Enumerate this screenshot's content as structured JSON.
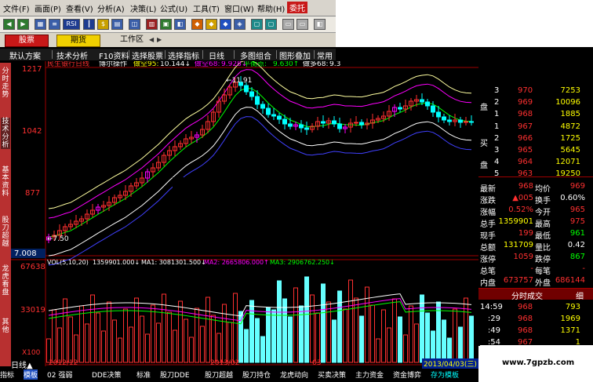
{
  "menu": [
    "文件(F)",
    "画面(P)",
    "查看(V)",
    "分析(A)",
    "决策(L)",
    "公式(U)",
    "工具(T)",
    "窗口(W)",
    "帮助(H)",
    "委托"
  ],
  "toolbar_icons": [
    "back-icon",
    "forward-icon",
    "grid-icon",
    "menu-icon",
    "rsi-icon",
    "ddd-icon",
    "ddd-icon",
    "chart-icon",
    "tool-icon",
    "tool-icon",
    "tool-icon",
    "tool-icon",
    "tool-icon",
    "window-icon",
    "window-icon",
    "window-icon",
    "tool-icon",
    "settings-icon"
  ],
  "toolbar_rsi": "RSI",
  "modtabs": {
    "stock": "股票",
    "futures": "期货",
    "workspace": "工作区"
  },
  "subtabs": [
    "默认方案",
    "技术分析",
    "F10资料",
    "选择股票",
    "选择指标",
    "日线",
    "多图组合",
    "图形叠加",
    "常用"
  ],
  "left_tabs": [
    "分时走势",
    "技术分析",
    "基本资料",
    "股刀超越",
    "龙虎看盘",
    "其他"
  ],
  "indicator": {
    "name": "民生银行日线",
    "method": "博尔操作",
    "buy95_label": "做空95:",
    "buy95_value": "10.144↓",
    "buy68_label": "做空68:",
    "buy68_value": "9.928↓",
    "mid_label": "平衡点:",
    "mid_value": "9.630↑",
    "low68_label": "做多68:",
    "low68_value": "9.3"
  },
  "price_axis": [
    "1217",
    "1042",
    "877",
    "7.008"
  ],
  "vol_axis": [
    "67638",
    "33019",
    "X100"
  ],
  "peak_label": "←11.91",
  "low_label": "←7.50",
  "vol_header": {
    "vol": "VOL(5,10,20)",
    "vol_value": "1359901.000↓",
    "ma1": "MA1: 3081301.500↓",
    "ma2": "MA2: 2665806.000↑",
    "ma3": "MA3: 2906762.250↓"
  },
  "date_labels": [
    "2012/12",
    "2013/02",
    "03"
  ],
  "bottom_bar": {
    "period": "日线▲",
    "tabs": [
      "指标",
      "模板",
      "02 强弱",
      "DDE决策",
      "标准",
      "股刀DDE",
      "股刀超越",
      "股刀持仓",
      "龙虎动向",
      "买卖决策",
      "主力资金",
      "资金博弈",
      "存为模板"
    ],
    "date": "2013/04/03(三)"
  },
  "order_book": {
    "sell": [
      {
        "lvl": "3",
        "price": "970",
        "vol": "7253"
      },
      {
        "lvl": "2",
        "price": "969",
        "vol": "10096"
      },
      {
        "lvl": "1",
        "price": "968",
        "vol": "1885"
      }
    ],
    "buy": [
      {
        "lvl": "1",
        "price": "967",
        "vol": "4872"
      },
      {
        "lvl": "2",
        "price": "966",
        "vol": "1725"
      },
      {
        "lvl": "3",
        "price": "965",
        "vol": "5645"
      },
      {
        "lvl": "4",
        "price": "964",
        "vol": "12071"
      },
      {
        "lvl": "5",
        "price": "963",
        "vol": "19250"
      }
    ],
    "sell_label": "盘",
    "buy_label_top": "买",
    "buy_label_bottom": "盘"
  },
  "quote": [
    {
      "l1": "最新",
      "v1": "968",
      "l2": "均价",
      "v2": "969"
    },
    {
      "l1": "涨跌",
      "v1": "▲005",
      "l2": "换手",
      "v2": "0.60%"
    },
    {
      "l1": "涨幅",
      "v1": "0.52%",
      "l2": "今开",
      "v2": "965"
    },
    {
      "l1": "总手",
      "v1": "1359901",
      "l2": "最高",
      "v2": "975"
    },
    {
      "l1": "现手",
      "v1": "199",
      "l2": "最低",
      "v2": "961"
    },
    {
      "l1": "总额",
      "v1": "131709",
      "l2": "量比",
      "v2": "0.42"
    },
    {
      "l1": "涨停",
      "v1": "1059",
      "l2": "跌停",
      "v2": "867"
    },
    {
      "l1": "总笔",
      "v1": "-",
      "l2": "每笔",
      "v2": "-"
    },
    {
      "l1": "内盘",
      "v1": "673757",
      "l2": "外盘",
      "v2": "686144"
    }
  ],
  "ticks_header": {
    "title": "分时成交",
    "detail": "细"
  },
  "ticks": [
    {
      "time": "14:59",
      "price": "968",
      "vol": "793"
    },
    {
      "time": ":29",
      "price": "968",
      "vol": "1969"
    },
    {
      "time": ":49",
      "price": "968",
      "vol": "1371"
    },
    {
      "time": ":54",
      "price": "967",
      "vol": "1"
    }
  ],
  "watermark": "www.7gpzb.com",
  "colors": {
    "red": "#ff3030",
    "green": "#00d000",
    "yellow": "#ffff00",
    "cyan": "#00ffff",
    "magenta": "#ff00ff",
    "white": "#ffffff",
    "tabred": "#c81818"
  },
  "chart_data": {
    "type": "line",
    "title": "民生银行日线",
    "xlabel": "",
    "ylabel": "",
    "ylim": [
      7.0,
      12.17
    ],
    "x": [
      "2012/12",
      "2013/02",
      "03",
      "2013/04/03"
    ]
  }
}
